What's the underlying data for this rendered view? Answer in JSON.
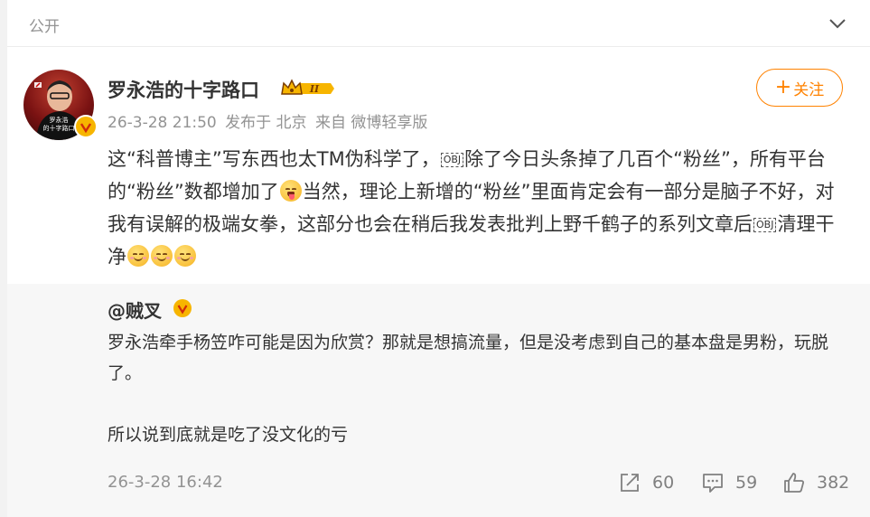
{
  "topbar": {
    "label": "公开"
  },
  "author": {
    "name": "罗永浩的十字路口",
    "level_badge": "II",
    "avatar_caption_1": "罗永浩",
    "avatar_caption_2": "的十字路口"
  },
  "meta": {
    "time": "26-3-28 21:50",
    "location": "发布于 北京",
    "source": "来自 微博轻享版"
  },
  "follow_button": {
    "plus": "+",
    "label": "关注"
  },
  "post": {
    "p1": "这“科普博主”写东西也太TM伪科学了，",
    "obj": "OBJ",
    "p2": "除了今日头条掉了几百个“粉丝”，所有平台的“粉丝”数都增加了",
    "p3": "当然，理论上新增的“粉丝”里面肯定会有一部分是脑子不好，对我有误解的极端女拳，这部分也会在稍后我发表批判上野千鹤子的系列文章后",
    "p4": "清理干净"
  },
  "repost": {
    "author": "@贼叉",
    "line1": "罗永浩牵手杨笠咋可能是因为欣赏？那就是想搞流量，但是没考虑到自己的基本盘是男粉，玩脱了。",
    "line2": "所以说到底就是吃了没文化的亏",
    "time": "26-3-28 16:42",
    "shares": "60",
    "comments": "59",
    "likes": "382"
  },
  "colors": {
    "accent": "#ff8200",
    "verified": "#f7b500",
    "text": "#333333",
    "muted": "#939393"
  }
}
